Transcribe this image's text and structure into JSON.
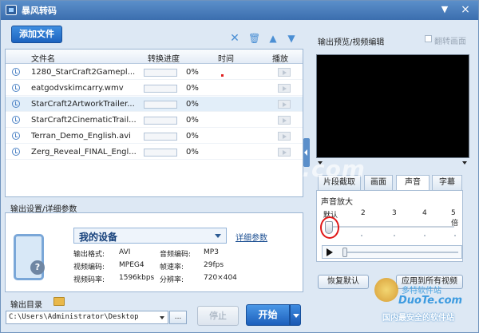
{
  "window": {
    "title": "暴风转码",
    "minimize": "▼",
    "close": "×"
  },
  "toolbar": {
    "add_label": "添加文件"
  },
  "list": {
    "headers": {
      "name": "文件名",
      "progress": "转换进度",
      "time": "时间",
      "play": "播放"
    },
    "rows": [
      {
        "name": "1280_StarCraft2Gamepl...",
        "pct": "0%",
        "progress": 0
      },
      {
        "name": "eatgodvskimcarry.wmv",
        "pct": "0%",
        "progress": 0
      },
      {
        "name": "StarCraft2ArtworkTrailer...",
        "pct": "0%",
        "progress": 0
      },
      {
        "name": "StarCraft2CinematicTrail...",
        "pct": "0%",
        "progress": 0
      },
      {
        "name": "Terran_Demo_English.avi",
        "pct": "0%",
        "progress": 0
      },
      {
        "name": "Zerg_Reveal_FINAL_Engl...",
        "pct": "0%",
        "progress": 0
      }
    ]
  },
  "settings": {
    "label": "输出设置/详细参数",
    "device": "我的设备",
    "detail_link": "详细参数",
    "params": {
      "fmt_label": "输出格式:",
      "fmt": "AVI",
      "acodec_label": "音频编码:",
      "acodec": "MP3",
      "vcodec_label": "视频编码:",
      "vcodec": "MPEG4",
      "fps_label": "帧速率:",
      "fps": "29fps",
      "vbitrate_label": "视频码率:",
      "vbitrate": "1596kbps",
      "res_label": "分辨率:",
      "res": "720×404"
    }
  },
  "output": {
    "label": "输出目录",
    "path": "C:\\Users\\Administrator\\Desktop",
    "browse": "...",
    "stop": "停止",
    "start": "开始"
  },
  "preview": {
    "label": "输出预览/视频编辑",
    "flip_label": "翻转画面",
    "tabs": [
      "片段截取",
      "画面",
      "声音",
      "字幕"
    ],
    "active_tab": "声音",
    "volume_label": "声音放大",
    "scale": [
      "默认",
      "2",
      "3",
      "4",
      "5倍"
    ],
    "volume_level": 1,
    "restore": "恢复默认",
    "apply_all": "应用到所有视频"
  },
  "watermark": {
    "main": "www.DuoTe.com",
    "cn": "多特软件站",
    "en": "DuoTe.com",
    "slogan": "国内最安全的软件站"
  }
}
